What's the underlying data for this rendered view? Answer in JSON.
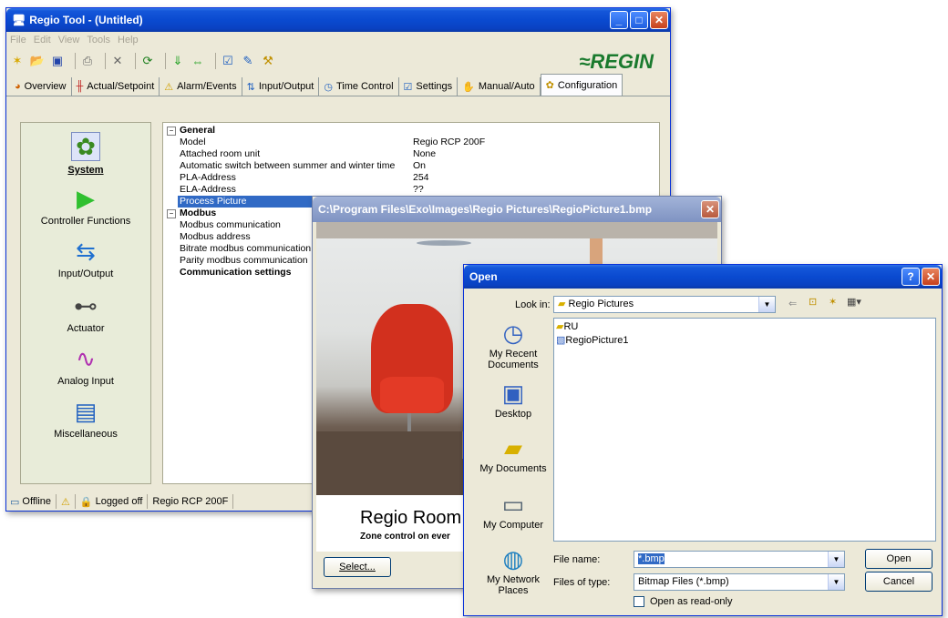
{
  "main_window": {
    "title": "Regio Tool - (Untitled)",
    "menu": [
      "File",
      "Edit",
      "View",
      "Tools",
      "Help"
    ],
    "brand": "≈REGIN",
    "tabs": [
      {
        "label": "Overview",
        "icon": "overview-icon"
      },
      {
        "label": "Actual/Setpoint",
        "icon": "setpoint-icon"
      },
      {
        "label": "Alarm/Events",
        "icon": "alarm-icon"
      },
      {
        "label": "Input/Output",
        "icon": "io-icon"
      },
      {
        "label": "Time Control",
        "icon": "clock-icon"
      },
      {
        "label": "Settings",
        "icon": "settings-icon"
      },
      {
        "label": "Manual/Auto",
        "icon": "manual-icon"
      },
      {
        "label": "Configuration",
        "icon": "config-icon"
      }
    ],
    "active_tab": "Configuration",
    "sidebar": [
      {
        "label": "System",
        "icon": "system-icon",
        "selected": true
      },
      {
        "label": "Controller Functions",
        "icon": "controller-icon"
      },
      {
        "label": "Input/Output",
        "icon": "input-output-icon"
      },
      {
        "label": "Actuator",
        "icon": "actuator-icon"
      },
      {
        "label": "Analog Input",
        "icon": "analog-input-icon"
      },
      {
        "label": "Miscellaneous",
        "icon": "misc-icon"
      }
    ],
    "properties": {
      "general_header": "General",
      "general": [
        {
          "key": "Model",
          "value": "Regio RCP 200F"
        },
        {
          "key": "Attached room unit",
          "value": "None"
        },
        {
          "key": "Automatic switch between summer and winter time",
          "value": "On"
        },
        {
          "key": "PLA-Address",
          "value": "254"
        },
        {
          "key": "ELA-Address",
          "value": "??"
        },
        {
          "key": "Process Picture",
          "value": ""
        }
      ],
      "modbus_header": "Modbus",
      "modbus": [
        {
          "key": "Modbus communication"
        },
        {
          "key": "Modbus address"
        },
        {
          "key": "Bitrate modbus communication"
        },
        {
          "key": "Parity modbus communication"
        }
      ],
      "comm_header": "Communication settings"
    },
    "status": {
      "connection": "Offline",
      "login": "Logged off",
      "model": "Regio RCP 200F"
    }
  },
  "picture_window": {
    "title": "C:\\Program Files\\Exo\\Images\\Regio Pictures\\RegioPicture1.bmp",
    "caption_title": "Regio Room",
    "caption_sub": "Zone control on ever",
    "select_label": "Select..."
  },
  "open_dialog": {
    "title": "Open",
    "look_in_label": "Look in:",
    "look_in_value": "Regio Pictures",
    "places": [
      {
        "label": "My Recent Documents",
        "icon": "recent-documents-icon"
      },
      {
        "label": "Desktop",
        "icon": "desktop-icon"
      },
      {
        "label": "My Documents",
        "icon": "my-documents-icon"
      },
      {
        "label": "My Computer",
        "icon": "my-computer-icon"
      },
      {
        "label": "My Network Places",
        "icon": "network-places-icon"
      }
    ],
    "files": [
      {
        "name": "RU",
        "type": "folder"
      },
      {
        "name": "RegioPicture1",
        "type": "bitmap"
      }
    ],
    "file_name_label": "File name:",
    "file_name_value": "*.bmp",
    "file_type_label": "Files of type:",
    "file_type_value": "Bitmap Files (*.bmp)",
    "readonly_label": "Open as read-only",
    "open_button": "Open",
    "cancel_button": "Cancel"
  }
}
